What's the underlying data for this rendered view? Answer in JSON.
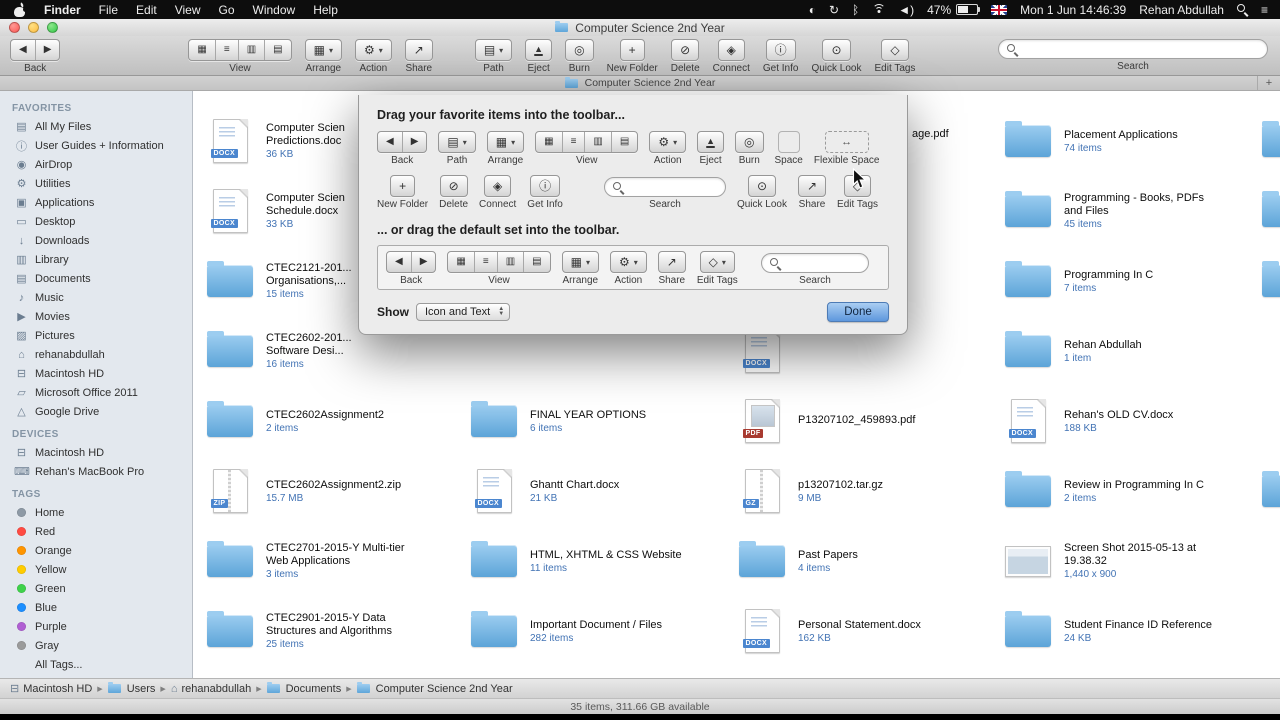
{
  "menu_bar": {
    "items": [
      "Finder",
      "File",
      "Edit",
      "View",
      "Go",
      "Window",
      "Help"
    ],
    "status_icons": [
      "display-icon",
      "time-machine-icon",
      "bluetooth-icon",
      "wifi-icon",
      "volume-icon"
    ],
    "battery": "47%",
    "datetime": "Mon 1 Jun  14:46:39",
    "user": "Rehan Abdullah"
  },
  "window": {
    "title": "Computer Science 2nd Year",
    "tab": {
      "title": "Computer Science 2nd Year",
      "new_tab": "+"
    }
  },
  "toolbar": {
    "items": [
      {
        "name": "back",
        "label": "Back",
        "type": "segmented-arrows",
        "segments": [
          "◀",
          "▶"
        ]
      },
      {
        "name": "view",
        "label": "View",
        "type": "view-segments",
        "segments": [
          "▦",
          "≡",
          "▥",
          "▤"
        ]
      },
      {
        "name": "arrange",
        "label": "Arrange",
        "type": "menu",
        "glyph": "▦"
      },
      {
        "name": "action",
        "label": "Action",
        "type": "menu",
        "glyph": "⚙"
      },
      {
        "name": "share",
        "label": "Share",
        "type": "button",
        "glyph": "↗"
      },
      {
        "name": "path",
        "label": "Path",
        "type": "menu",
        "glyph": "▤"
      },
      {
        "name": "eject",
        "label": "Eject",
        "type": "button",
        "glyph": "▲"
      },
      {
        "name": "burn",
        "label": "Burn",
        "type": "button",
        "glyph": "◎"
      },
      {
        "name": "new-folder",
        "label": "New Folder",
        "type": "button",
        "glyph": "+"
      },
      {
        "name": "delete",
        "label": "Delete",
        "type": "button",
        "glyph": "⊘"
      },
      {
        "name": "connect",
        "label": "Connect",
        "type": "button",
        "glyph": "◈"
      },
      {
        "name": "get-info",
        "label": "Get Info",
        "type": "button",
        "glyph": "ⓘ"
      },
      {
        "name": "quick-look",
        "label": "Quick Look",
        "type": "button",
        "glyph": "⊙"
      },
      {
        "name": "edit-tags",
        "label": "Edit Tags",
        "type": "button",
        "glyph": "◇"
      },
      {
        "name": "search",
        "label": "Search",
        "type": "search"
      }
    ]
  },
  "sidebar": {
    "sections": [
      {
        "title": "FAVORITES",
        "items": [
          {
            "label": "All My Files",
            "icon": "all-my-files-icon"
          },
          {
            "label": "User Guides + Information",
            "icon": "info-folder-icon"
          },
          {
            "label": "AirDrop",
            "icon": "airdrop-icon"
          },
          {
            "label": "Utilities",
            "icon": "utilities-icon"
          },
          {
            "label": "Applications",
            "icon": "applications-icon"
          },
          {
            "label": "Desktop",
            "icon": "desktop-icon"
          },
          {
            "label": "Downloads",
            "icon": "downloads-icon"
          },
          {
            "label": "Library",
            "icon": "library-icon"
          },
          {
            "label": "Documents",
            "icon": "documents-icon"
          },
          {
            "label": "Music",
            "icon": "music-icon"
          },
          {
            "label": "Movies",
            "icon": "movies-icon"
          },
          {
            "label": "Pictures",
            "icon": "pictures-icon"
          },
          {
            "label": "rehanabdullah",
            "icon": "home-icon"
          },
          {
            "label": "Macintosh HD",
            "icon": "hdd-icon"
          },
          {
            "label": "Microsoft Office 2011",
            "icon": "folder-icon"
          },
          {
            "label": "Google Drive",
            "icon": "google-drive-icon"
          }
        ]
      },
      {
        "title": "DEVICES",
        "items": [
          {
            "label": "Macintosh HD",
            "icon": "hdd-icon"
          },
          {
            "label": "Rehan's MacBook Pro",
            "icon": "macbook-icon"
          }
        ]
      },
      {
        "title": "TAGS",
        "items": [
          {
            "label": "Home",
            "dot": "#8e9aa6"
          },
          {
            "label": "Red",
            "dot": "#ff4b42"
          },
          {
            "label": "Orange",
            "dot": "#ff9500"
          },
          {
            "label": "Yellow",
            "dot": "#ffcc00"
          },
          {
            "label": "Green",
            "dot": "#3fd24a"
          },
          {
            "label": "Blue",
            "dot": "#1d8fff"
          },
          {
            "label": "Purple",
            "dot": "#b05fd3"
          },
          {
            "label": "Gray",
            "dot": "#9b9b9b"
          },
          {
            "label": "All Tags...",
            "dot": null
          }
        ]
      }
    ]
  },
  "files": {
    "hidden_fragment": "age.pdf",
    "right_edge_rows": [
      0,
      1,
      2,
      5
    ],
    "columns": [
      [
        {
          "icon": "docx",
          "name": "Computer Scien\nPredictions.doc",
          "info": "36 KB"
        },
        {
          "icon": "docx",
          "name": "Computer Scien\nSchedule.docx",
          "info": "33 KB"
        },
        {
          "icon": "folder",
          "name": "CTEC2121-201...\nOrganisations,...",
          "info": "15 items"
        },
        {
          "icon": "folder",
          "name": "CTEC2602-201...\nSoftware Desi...",
          "info": "16 items"
        },
        {
          "icon": "folder",
          "name": "CTEC2602Assignment2",
          "info": "2 items"
        },
        {
          "icon": "zip",
          "name": "CTEC2602Assignment2.zip",
          "info": "15.7 MB"
        },
        {
          "icon": "folder",
          "name": "CTEC2701-2015-Y Multi-tier\nWeb Applications",
          "info": "3 items"
        },
        {
          "icon": "folder",
          "name": "CTEC2901-2015-Y Data\nStructures and Algorithms",
          "info": "25 items"
        }
      ],
      [
        null,
        null,
        null,
        null,
        {
          "icon": "folder",
          "name": "FINAL YEAR OPTIONS",
          "info": "6 items"
        },
        {
          "icon": "docx",
          "name": "Ghantt Chart.docx",
          "info": "21 KB"
        },
        {
          "icon": "folder",
          "name": "HTML, XHTML & CSS Website",
          "info": "11 items"
        },
        {
          "icon": "folder",
          "name": "Important Document / Files",
          "info": "282 items"
        }
      ],
      [
        null,
        null,
        null,
        {
          "icon": "docx",
          "name": "",
          "info": ""
        },
        {
          "icon": "pdf",
          "name": "P13207102_459893.pdf",
          "info": ""
        },
        {
          "icon": "gz",
          "name": "p13207102.tar.gz",
          "info": "9 MB"
        },
        {
          "icon": "folder",
          "name": "Past Papers",
          "info": "4 items"
        },
        {
          "icon": "docx",
          "name": "Personal Statement.docx",
          "info": "162 KB"
        }
      ],
      [
        {
          "icon": "folder",
          "name": "Placement Applications",
          "info": "74 items"
        },
        {
          "icon": "folder",
          "name": "Programming - Books, PDFs\nand Files",
          "info": "45 items"
        },
        {
          "icon": "folder",
          "name": "Programming In C",
          "info": "7 items"
        },
        {
          "icon": "folder",
          "name": "Rehan Abdullah",
          "info": "1 item"
        },
        {
          "icon": "docx",
          "name": "Rehan's OLD CV.docx",
          "info": "188 KB"
        },
        {
          "icon": "folder",
          "name": "Review in Programming In C",
          "info": "2 items"
        },
        {
          "icon": "image",
          "name": "Screen Shot 2015-05-13 at\n19.38.32",
          "info": "1,440 x 900"
        },
        {
          "icon": "folder",
          "name": "Student Finance ID Reference",
          "info": "24 KB"
        }
      ]
    ]
  },
  "dialog": {
    "title": "Drag your favorite items into the toolbar...",
    "subtitle": "... or drag the default set into the toolbar.",
    "show_label": "Show",
    "show_value": "Icon and Text",
    "done_label": "Done",
    "row1": [
      {
        "name": "back",
        "label": "Back",
        "type": "segmented-arrows",
        "segments": [
          "◀",
          "▶"
        ]
      },
      {
        "name": "path",
        "label": "Path",
        "type": "menu",
        "glyph": "▤"
      },
      {
        "name": "arrange",
        "label": "Arrange",
        "type": "menu",
        "glyph": "▦"
      },
      {
        "name": "view",
        "label": "View",
        "type": "view-segments",
        "segments": [
          "▦",
          "≡",
          "▥",
          "▤"
        ]
      },
      {
        "name": "action",
        "label": "Action",
        "type": "menu",
        "glyph": "⚙"
      },
      {
        "name": "eject",
        "label": "Eject",
        "type": "button",
        "glyph": "▲"
      },
      {
        "name": "burn",
        "label": "Burn",
        "type": "button",
        "glyph": "◎"
      },
      {
        "name": "space",
        "label": "Space",
        "type": "space"
      },
      {
        "name": "flexible-space",
        "label": "Flexible Space",
        "type": "flex-space"
      }
    ],
    "row2": [
      {
        "name": "new-folder",
        "label": "New Folder",
        "type": "button",
        "glyph": "+"
      },
      {
        "name": "delete",
        "label": "Delete",
        "type": "button",
        "glyph": "⊘"
      },
      {
        "name": "connect",
        "label": "Connect",
        "type": "button",
        "glyph": "◈"
      },
      {
        "name": "get-info",
        "label": "Get Info",
        "type": "button",
        "glyph": "ⓘ"
      },
      {
        "name": "search",
        "label": "Search",
        "type": "search",
        "small": true
      },
      {
        "name": "quick-look",
        "label": "Quick Look",
        "type": "button",
        "glyph": "⊙"
      },
      {
        "name": "share",
        "label": "Share",
        "type": "button",
        "glyph": "↗"
      },
      {
        "name": "edit-tags",
        "label": "Edit Tags",
        "type": "button",
        "glyph": "◇"
      }
    ],
    "default_set": [
      {
        "name": "back",
        "label": "Back",
        "type": "segmented-arrows",
        "segments": [
          "◀",
          "▶"
        ]
      },
      {
        "name": "view",
        "label": "View",
        "type": "view-segments",
        "segments": [
          "▦",
          "≡",
          "▥",
          "▤"
        ]
      },
      {
        "name": "arrange",
        "label": "Arrange",
        "type": "menu",
        "glyph": "▦"
      },
      {
        "name": "action",
        "label": "Action",
        "type": "menu",
        "glyph": "⚙"
      },
      {
        "name": "share",
        "label": "Share",
        "type": "button",
        "glyph": "↗"
      },
      {
        "name": "edit-tags",
        "label": "Edit Tags",
        "type": "menu",
        "glyph": "◇"
      },
      {
        "name": "search",
        "label": "Search",
        "type": "search",
        "xsmall": true
      }
    ]
  },
  "path_bar": [
    {
      "label": "Macintosh HD",
      "icon": "hdd-icon"
    },
    {
      "label": "Users",
      "icon": "folder-icon"
    },
    {
      "label": "rehanabdullah",
      "icon": "home-icon"
    },
    {
      "label": "Documents",
      "icon": "folder-icon"
    },
    {
      "label": "Computer Science 2nd Year",
      "icon": "folder-icon"
    }
  ],
  "status_bar": "35 items, 311.66 GB available"
}
